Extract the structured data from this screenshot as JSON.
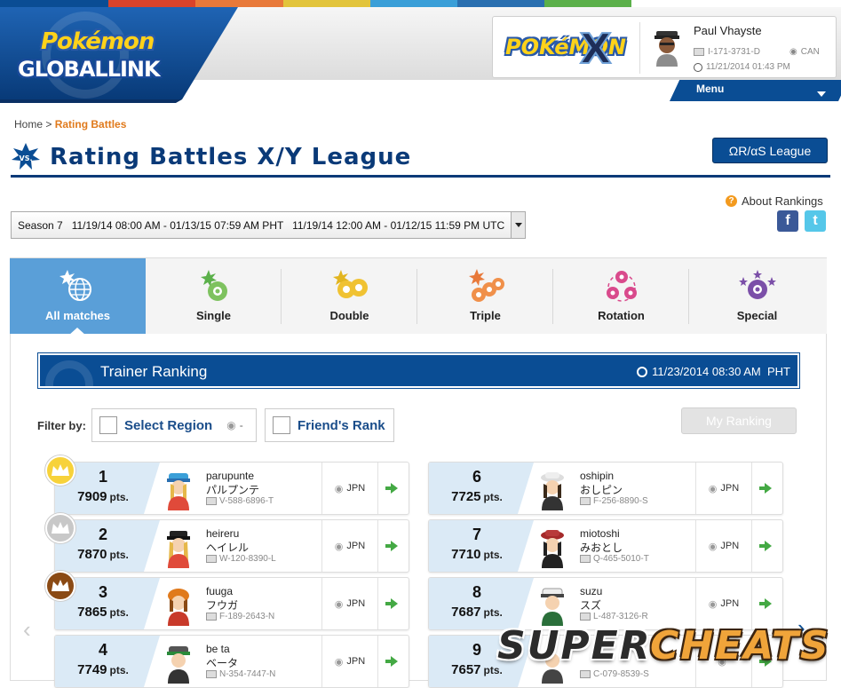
{
  "colors": {
    "brand_blue": "#0a4d94",
    "title_blue": "#0a3a78",
    "accent_orange": "#e07a1c",
    "active_tab": "#5a9fd8",
    "rank_bg": "#dbeaf6",
    "go_arrow": "#44a944",
    "gold": "#f0c419",
    "silver": "#bdbdbd",
    "bronze": "#8b4a14",
    "top_stripe": [
      "#0a4d94",
      "#d9432b",
      "#e8793a",
      "#e2c43c",
      "#3a9fd8",
      "#2a6fb0",
      "#5bb04a",
      "#ffffff"
    ]
  },
  "header": {
    "logo_word1": "Pokémon",
    "logo_word2": "GLOBALLINK",
    "game_logo_word": "POKéMON",
    "game_logo_letter": "X",
    "user": {
      "name": "Paul Vhayste",
      "id": "I-171-3731-D",
      "country": "CAN",
      "last_login": "11/21/2014 01:43 PM",
      "avatar_icon": "trainer-avatar-icon"
    },
    "menu_label": "Menu"
  },
  "breadcrumb": {
    "home": "Home",
    "separator": ">",
    "current": "Rating Battles"
  },
  "page": {
    "title": "Rating Battles X/Y League",
    "title_icon": "vs-icon",
    "title_icon_text": "VS.",
    "oras_button": "ΩR/αS League",
    "about_rankings": "About Rankings",
    "about_icon_text": "?",
    "facebook_glyph": "f",
    "twitter_glyph": "t"
  },
  "season": {
    "selected": "Season 7   11/19/14 08:00 AM - 01/13/15 07:59 AM PHT   11/19/14 12:00 AM - 01/12/15 11:59 PM UTC"
  },
  "tabs": [
    {
      "label": "All matches",
      "icon": "globe-icon",
      "active": true
    },
    {
      "label": "Single",
      "icon": "single-battle-icon",
      "active": false
    },
    {
      "label": "Double",
      "icon": "double-battle-icon",
      "active": false
    },
    {
      "label": "Triple",
      "icon": "triple-battle-icon",
      "active": false
    },
    {
      "label": "Rotation",
      "icon": "rotation-battle-icon",
      "active": false
    },
    {
      "label": "Special",
      "icon": "special-battle-icon",
      "active": false
    }
  ],
  "ranking": {
    "title": "Trainer Ranking",
    "updated": "11/23/2014 08:30 AM  PHT",
    "filter_label": "Filter by:",
    "region_label": "Select Region",
    "region_value": "-",
    "friends_label": "Friend's Rank",
    "my_ranking": "My Ranking",
    "pts_unit": "pts.",
    "prev_glyph": "‹",
    "next_glyph": "›",
    "entries": [
      {
        "rank": "1",
        "points": "7909",
        "name": "parupunte",
        "name_jp": "パルプンテ",
        "id": "V-588-6896-T",
        "country": "JPN",
        "crown": "gold"
      },
      {
        "rank": "2",
        "points": "7870",
        "name": "heireru",
        "name_jp": "ヘイレル",
        "id": "W-120-8390-L",
        "country": "JPN",
        "crown": "silver"
      },
      {
        "rank": "3",
        "points": "7865",
        "name": "fuuga",
        "name_jp": "フウガ",
        "id": "F-189-2643-N",
        "country": "JPN",
        "crown": "bronze"
      },
      {
        "rank": "4",
        "points": "7749",
        "name": "be ta",
        "name_jp": "ベータ",
        "id": "N-354-7447-N",
        "country": "JPN",
        "crown": ""
      },
      {
        "rank": "6",
        "points": "7725",
        "name": "oshipin",
        "name_jp": "おしピン",
        "id": "F-256-8890-S",
        "country": "JPN",
        "crown": ""
      },
      {
        "rank": "7",
        "points": "7710",
        "name": "miotoshi",
        "name_jp": "みおとし",
        "id": "Q-465-5010-T",
        "country": "JPN",
        "crown": ""
      },
      {
        "rank": "8",
        "points": "7687",
        "name": "suzu",
        "name_jp": "スズ",
        "id": "L-487-3126-R",
        "country": "JPN",
        "crown": ""
      },
      {
        "rank": "9",
        "points": "7657",
        "name": "",
        "name_jp": "",
        "id": "C-079-8539-S",
        "country": "",
        "crown": ""
      }
    ]
  },
  "watermark": {
    "word1": "SUPER",
    "word2": "CHEATS"
  }
}
